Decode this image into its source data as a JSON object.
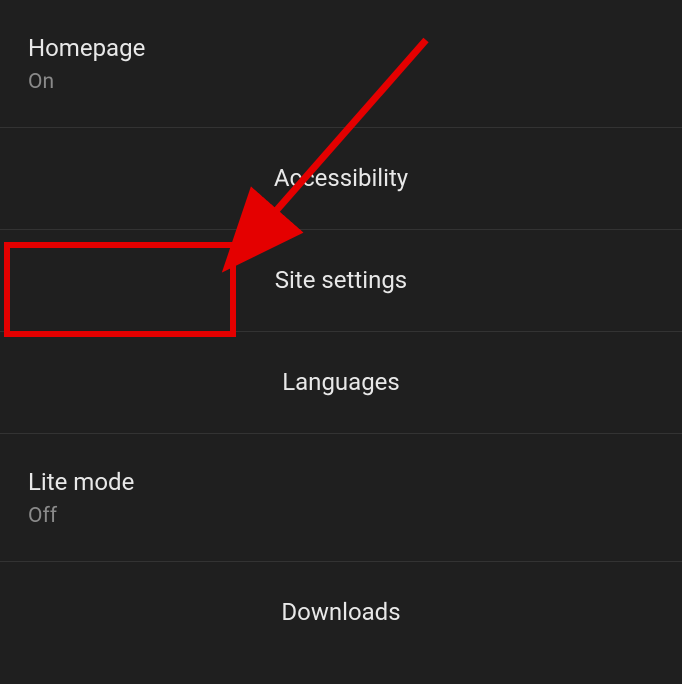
{
  "settings": {
    "homepage": {
      "label": "Homepage",
      "value": "On"
    },
    "accessibility": {
      "label": "Accessibility"
    },
    "site_settings": {
      "label": "Site settings"
    },
    "languages": {
      "label": "Languages"
    },
    "lite_mode": {
      "label": "Lite mode",
      "value": "Off"
    },
    "downloads": {
      "label": "Downloads"
    }
  },
  "annotation": {
    "highlight_target": "site-settings"
  }
}
